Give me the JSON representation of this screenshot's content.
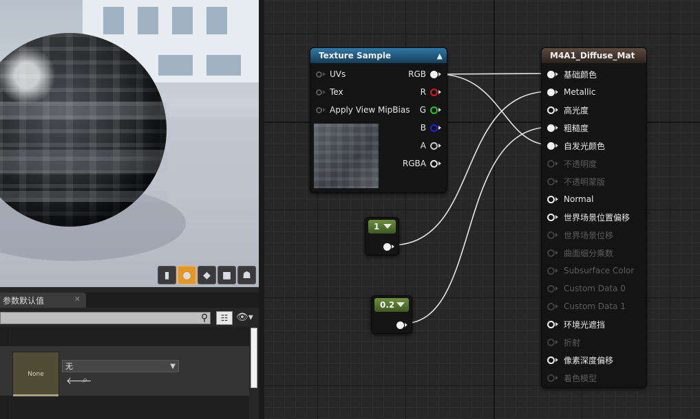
{
  "viewport": {
    "toolbar": [
      {
        "name": "cylinder-preview-icon",
        "glyph": "▮"
      },
      {
        "name": "sphere-preview-icon",
        "glyph": "●",
        "active": true
      },
      {
        "name": "plane-preview-icon",
        "glyph": "◆"
      },
      {
        "name": "cube-preview-icon",
        "glyph": "■"
      },
      {
        "name": "teapot-preview-icon",
        "glyph": "☗"
      }
    ]
  },
  "details": {
    "tab_label": "参数默认值",
    "tab_close": "✕",
    "search_placeholder": "",
    "texture_thumb_label": "None",
    "combo_value": "无",
    "combo_arrow": "▼",
    "use_selected_glyph": "🡐",
    "browse_glyph": "⌕"
  },
  "graph": {
    "texture_sample": {
      "title": "Texture Sample",
      "collapse_glyph": "▲",
      "inputs": [
        "UVs",
        "Tex",
        "Apply View MipBias"
      ],
      "outputs": [
        {
          "label": "RGB",
          "color": "#f2f2f2",
          "connected": true
        },
        {
          "label": "R",
          "color": "#e01818",
          "connected": false
        },
        {
          "label": "G",
          "color": "#18d018",
          "connected": false
        },
        {
          "label": "B",
          "color": "#2020e0",
          "connected": false
        },
        {
          "label": "A",
          "color": "#c8c8c8",
          "connected": false
        },
        {
          "label": "RGBA",
          "color": "#e8e8e8",
          "connected": false
        }
      ]
    },
    "constant_1": {
      "value": "1"
    },
    "constant_2": {
      "value": "0.2"
    },
    "material": {
      "title": "M4A1_Diffuse_Mat",
      "inputs": [
        {
          "label": "基础颜色",
          "state": "connected"
        },
        {
          "label": "Metallic",
          "state": "connected"
        },
        {
          "label": "高光度",
          "state": "enabled"
        },
        {
          "label": "粗糙度",
          "state": "connected"
        },
        {
          "label": "自发光颜色",
          "state": "connected"
        },
        {
          "label": "不透明度",
          "state": "disabled"
        },
        {
          "label": "不透明蒙版",
          "state": "disabled"
        },
        {
          "label": "Normal",
          "state": "enabled"
        },
        {
          "label": "世界场景位置偏移",
          "state": "enabled"
        },
        {
          "label": "世界场景位移",
          "state": "disabled"
        },
        {
          "label": "曲面细分乘数",
          "state": "disabled"
        },
        {
          "label": "Subsurface Color",
          "state": "disabled"
        },
        {
          "label": "Custom Data 0",
          "state": "disabled"
        },
        {
          "label": "Custom Data 1",
          "state": "disabled"
        },
        {
          "label": "环境光遮挡",
          "state": "enabled"
        },
        {
          "label": "折射",
          "state": "disabled"
        },
        {
          "label": "像素深度偏移",
          "state": "enabled"
        },
        {
          "label": "着色模型",
          "state": "disabled"
        }
      ]
    }
  }
}
